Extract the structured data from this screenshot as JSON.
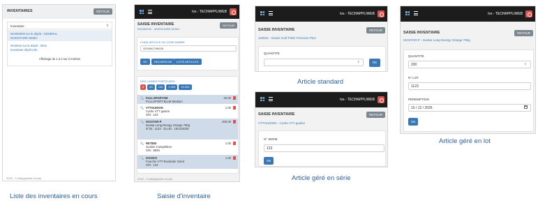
{
  "captions": {
    "list": "Liste des inventaires en cours",
    "entry": "Saisie d'inventaire",
    "standard": "Article standard",
    "serial": "Article géré en série",
    "lot": "Article géré en lot"
  },
  "common": {
    "user": "tvs - TECHAPPLIWEB",
    "return": "RETOUR",
    "ok": "OK",
    "saisie_title": "SAISIE INVENTAIRE",
    "footer": "2020 - © AtlAppliweb Goulia"
  },
  "list_screen": {
    "title": "INVENTAIRES",
    "return": "RETOUR",
    "column_header": "Inventaire",
    "items": [
      {
        "line1": "INV050000 sur le dépôt : GENERAL",
        "line2": "INVENTAIRE DEMO"
      },
      {
        "line1": "INV0010 sur le dépôt : 0001",
        "line2": "Inventaire dépôt Lille"
      }
    ],
    "pager": "Affichage de 1 à 2 sur 2 entrées",
    "footer": "2020 - © AtlAppliweb Goulia"
  },
  "entry_screen": {
    "subtitle": "INV050000 - INVENTAIRE DEMO",
    "scan_label": "CODE ARTICLE OU CODE BARRE",
    "scan_value": "3324941799026",
    "search_buttons": [
      "OK",
      "RECHERCHE",
      "LISTE ARTICLES"
    ],
    "last_lines_label": "DES LIGNES PORTEUSES",
    "pages": [
      "5",
      "50",
      "100",
      "1 000",
      "10 000"
    ],
    "lines": [
      {
        "code": "FULLSPORTSM",
        "desc": "FULLSPORT BLUE Medium",
        "qty": "20.00"
      },
      {
        "code": "VTTGUIDON",
        "desc": "Codre VTT guidon",
        "extra": "S/N : 123",
        "qty": "1.00"
      },
      {
        "code": "ISOSTAR-P",
        "desc": "Isostar Long Energy Orange 790g",
        "extra": "N°lot : 1123 · DLUO : 15/12/2026",
        "qty": "200.00"
      },
      {
        "code": "RETENI",
        "desc": "Guidon Compétition",
        "extra": "S/N : 9845",
        "qty": "1.00"
      },
      {
        "code": "ISSOKO",
        "desc": "Fourche VTT Rockrider Grind",
        "extra": "S/N : 123",
        "qty": "1.00"
      }
    ],
    "footer": "2020 - © AtlAppliweb Goulia"
  },
  "standard_screen": {
    "subtitle": "118942 - Giants Golf PING Premium Plus",
    "qty_label": "QUANTITE",
    "qty_value": ""
  },
  "serial_screen": {
    "subtitle": "VTTGUIDON - Codre VTT guidon",
    "serial_label": "N° SERIE",
    "serial_value": "123"
  },
  "lot_screen": {
    "subtitle": "ISOSTAR-P - Isostar Long Energy Orange 790g",
    "qty_label": "QUANTITE",
    "qty_value": "200",
    "lot_label": "N° LOT",
    "lot_value": "1123",
    "expiry_label": "PEREMPTION",
    "expiry_value": "15 / 12 / 2026"
  }
}
